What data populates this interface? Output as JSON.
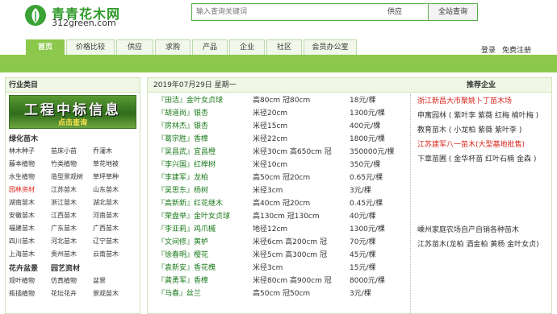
{
  "header": {
    "logo_name": "青青花木网",
    "logo_domain": "312green.com",
    "search_placeholder": "输入查询关键词",
    "search_type": "供应",
    "search_button": "全站查询"
  },
  "nav": {
    "tabs": [
      "首页",
      "价格比较",
      "供应",
      "求购",
      "产品",
      "企业",
      "社区",
      "会员办公室"
    ],
    "login": "登录",
    "register": "免费注册"
  },
  "sidebar": {
    "title": "行业类目",
    "banner_main": "工程中标信息",
    "banner_sub": "点击查询",
    "category_title": "绿化苗木",
    "categories": [
      [
        "林木种子",
        "苗床小苗",
        "乔灌木"
      ],
      [
        "藤本植物",
        "竹类植物",
        "草花地被"
      ],
      [
        "水生植物",
        "造型景观树",
        "草坪草种"
      ],
      [
        "园林资材",
        "江苏苗木",
        "山东苗木"
      ],
      [
        "湖南苗木",
        "浙江苗木",
        "湖北苗木"
      ],
      [
        "安徽苗木",
        "江西苗木",
        "河南苗木"
      ],
      [
        "福建苗木",
        "广东苗木",
        "广西苗木"
      ],
      [
        "四川苗木",
        "河北苗木",
        "辽宁苗木"
      ],
      [
        "上海苗木",
        "贵州苗木",
        "云南苗木"
      ]
    ],
    "hot_item": "园林资材",
    "sub_titles": [
      "花卉盆景",
      "园艺资材"
    ],
    "sub_items": [
      [
        "观叶植物",
        "仿真植物",
        "盆景"
      ],
      [
        "瓶插植物",
        "花坛花卉",
        "景观苗木"
      ]
    ],
    "colors": {
      "green_bar": "#8cc84b",
      "hot_text": "#d9261c"
    }
  },
  "main": {
    "date": "2019年07月29日 星期一",
    "rec_title": "推荐企业",
    "listings": [
      {
        "name": "『田洁』金叶女贞球",
        "spec": "高80cm 冠80cm",
        "price": "18元/棵"
      },
      {
        "name": "『胡道尚』银杏",
        "spec": "米径20cm",
        "price": "1300元/棵"
      },
      {
        "name": "『房林杰』银杏",
        "spec": "米径15cm",
        "price": "400元/棵"
      },
      {
        "name": "『葛宗胜』香樟",
        "spec": "米径22cm",
        "price": "1800元/棵"
      },
      {
        "name": "『吴昌武』宜昌橙",
        "spec": "米径30cm 高650cm 冠",
        "price": "350000元/棵"
      },
      {
        "name": "『李兴国』红榉树",
        "spec": "米径10cm",
        "price": "350元/棵"
      },
      {
        "name": "『李建军』龙柏",
        "spec": "高50cm 冠20cm",
        "price": "0.65元/棵"
      },
      {
        "name": "『吴思东』杨树",
        "spec": "米径3cm",
        "price": "3元/棵"
      },
      {
        "name": "『高新新』红花继木",
        "spec": "高40cm 冠20cm",
        "price": "0.45元/棵"
      },
      {
        "name": "『荣盘举』金叶女贞球",
        "spec": "高130cm 冠130cm",
        "price": "40元/棵"
      },
      {
        "name": "『李亚莉』鸡爪槭",
        "spec": "地径12cm",
        "price": "1300元/棵"
      },
      {
        "name": "『文间修』黄栌",
        "spec": "米径6cm 高200cm 冠",
        "price": "70元/棵"
      },
      {
        "name": "『徐春明』樱花",
        "spec": "米径5cm 高300cm 冠",
        "price": "45元/棵"
      },
      {
        "name": "『袁新安』香花槐",
        "spec": "米径3cm",
        "price": "15元/棵"
      },
      {
        "name": "『龚勇军』香樟",
        "spec": "米径80cm 高900cm 冠",
        "price": "8000元/棵"
      },
      {
        "name": "『马春』丝兰",
        "spec": "高50cm 冠50cm",
        "price": "3元/棵"
      }
    ],
    "recommended": [
      {
        "text": "浙江新昌大市聚姚卜丁苗木场",
        "red": true
      },
      {
        "text": "申寓园林 ( 紫叶李 紫薇 红梅 榆叶梅 )",
        "red": false
      },
      {
        "text": "教育苗木 ( 小龙柏 紫薇 紫叶李 )",
        "red": false
      },
      {
        "text": "江苏建军八一苗木(大型基地批售)",
        "red": true
      },
      {
        "text": "下章苗圃 ( 金华杯苗 红叶石楠 金森 )",
        "red": false
      },
      {
        "text": "嵊州家庭农场自产自销各种苗木",
        "red": false
      },
      {
        "text": "江苏苗木(龙柏 酒金柏 黄杨 金叶女贞)",
        "red": false
      }
    ]
  }
}
